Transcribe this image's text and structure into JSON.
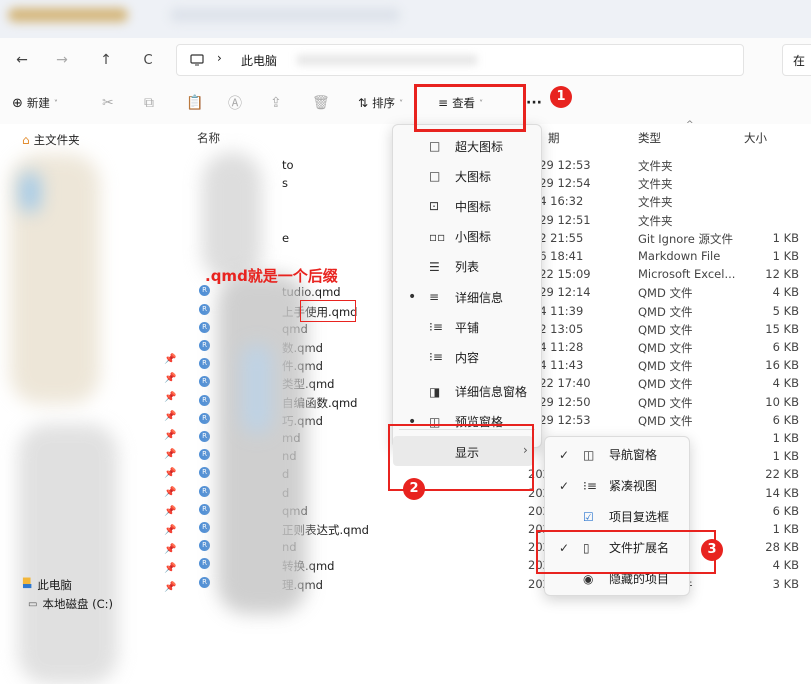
{
  "addressbar": {
    "back": "←",
    "forward": "→",
    "up": "↑",
    "refresh": "C",
    "separator": "›",
    "location": "此电脑",
    "search_partial": "在"
  },
  "toolbar": {
    "new_label": "新建",
    "sort_label": "排序",
    "view_label": "查看",
    "more_label": "···"
  },
  "sidebar": {
    "home": "主文件夹",
    "this_pc": "此电脑",
    "local_disk": "本地磁盘 (C:)"
  },
  "columns": {
    "name": "名称",
    "date": "期",
    "type": "类型",
    "size": "大小"
  },
  "rows": [
    {
      "name": "to",
      "date": "3/29 12:53",
      "type": "文件夹",
      "size": ""
    },
    {
      "name": "s",
      "date": "3/29 12:54",
      "type": "文件夹",
      "size": ""
    },
    {
      "name": "",
      "date": "3/4 16:32",
      "type": "文件夹",
      "size": ""
    },
    {
      "name": "",
      "date": "3/29 12:51",
      "type": "文件夹",
      "size": ""
    },
    {
      "name": "e",
      "date": "3/2 21:55",
      "type": "Git Ignore 源文件",
      "size": "1 KB"
    },
    {
      "name": "",
      "date": "5/6 18:41",
      "type": "Markdown File",
      "size": "1 KB"
    },
    {
      "name": "",
      "date": "2/22 15:09",
      "type": "Microsoft Excel...",
      "size": "12 KB"
    },
    {
      "name": "tudio.qmd",
      "date": "3/29 12:14",
      "type": "QMD 文件",
      "size": "4 KB"
    },
    {
      "name": "上手使用.qmd",
      "date": "3/4 11:39",
      "type": "QMD 文件",
      "size": "5 KB"
    },
    {
      "name": "qmd",
      "date": "3/2 13:05",
      "type": "QMD 文件",
      "size": "15 KB"
    },
    {
      "name": "数.qmd",
      "date": "3/4 11:28",
      "type": "QMD 文件",
      "size": "6 KB"
    },
    {
      "name": "件.qmd",
      "date": "3/4 11:43",
      "type": "QMD 文件",
      "size": "16 KB"
    },
    {
      "name": "类型.qmd",
      "date": "3/22 17:40",
      "type": "QMD 文件",
      "size": "4 KB"
    },
    {
      "name": "自编函数.qmd",
      "date": "3/29 12:50",
      "type": "QMD 文件",
      "size": "10 KB"
    },
    {
      "name": "巧.qmd",
      "date": "3/29 12:53",
      "type": "QMD 文件",
      "size": "6 KB"
    },
    {
      "name": "md",
      "date": "",
      "type": "",
      "size": "1 KB"
    },
    {
      "name": "nd",
      "date": "",
      "type": "",
      "size": "1 KB"
    },
    {
      "name": "d",
      "date": "2024/",
      "type": "",
      "size": "22 KB"
    },
    {
      "name": "d",
      "date": "2024/",
      "type": "",
      "size": "14 KB"
    },
    {
      "name": "qmd",
      "date": "2024/",
      "type": "",
      "size": "6 KB"
    },
    {
      "name": "正则表达式.qmd",
      "date": "2024/",
      "type": "",
      "size": "1 KB"
    },
    {
      "name": "nd",
      "date": "2024/",
      "type": "",
      "size": "28 KB"
    },
    {
      "name": "转换.qmd",
      "date": "2024/",
      "type": "",
      "size": "4 KB"
    },
    {
      "name": "理.qmd",
      "date": "2024/8/22 19:02",
      "type": "QMD 文件",
      "size": "3 KB"
    }
  ],
  "view_menu": [
    {
      "label": "超大图标",
      "icon": "□",
      "bullet": ""
    },
    {
      "label": "大图标",
      "icon": "□",
      "bullet": ""
    },
    {
      "label": "中图标",
      "icon": "⊡",
      "bullet": ""
    },
    {
      "label": "小图标",
      "icon": "▫▫",
      "bullet": ""
    },
    {
      "label": "列表",
      "icon": "☰",
      "bullet": ""
    },
    {
      "label": "详细信息",
      "icon": "≡",
      "bullet": "•"
    },
    {
      "label": "平铺",
      "icon": "⁝≡",
      "bullet": ""
    },
    {
      "label": "内容",
      "icon": "⁝≡",
      "bullet": ""
    },
    {
      "label": "详细信息窗格",
      "icon": "◨",
      "bullet": ""
    },
    {
      "label": "预览窗格",
      "icon": "◫",
      "bullet": "•"
    }
  ],
  "show_item": {
    "label": "显示",
    "arrow": "›"
  },
  "show_submenu": [
    {
      "label": "导航窗格",
      "icon": "◫",
      "check": "✓"
    },
    {
      "label": "紧凑视图",
      "icon": "⁝≡",
      "check": "✓"
    },
    {
      "label": "项目复选框",
      "icon": "☑",
      "check": ""
    },
    {
      "label": "文件扩展名",
      "icon": "▯",
      "check": "✓"
    },
    {
      "label": "隐藏的项目",
      "icon": "◉",
      "check": ""
    }
  ],
  "annotations": {
    "text": ".qmd就是一个后缀",
    "badge1": "1",
    "badge2": "2",
    "badge3": "3"
  },
  "colors": {
    "accent": "#e8231f",
    "folder": "#f5c542",
    "selection": "#eaeaea"
  }
}
